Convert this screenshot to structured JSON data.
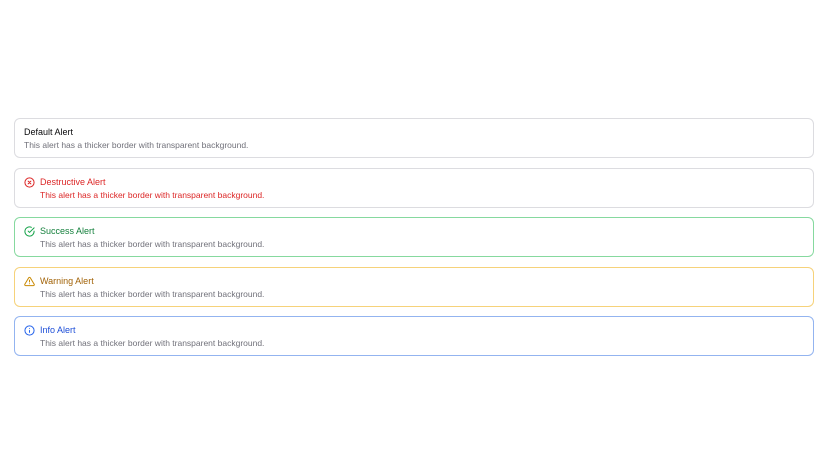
{
  "alerts": [
    {
      "variant": "default",
      "title": "Default Alert",
      "description": "This alert has a thicker border with transparent background.",
      "icon": null,
      "border_color": "#dcdce0",
      "title_color": "#09090b",
      "desc_color": "#71717a"
    },
    {
      "variant": "destructive",
      "title": "Destructive Alert",
      "description": "This alert has a thicker border with transparent background.",
      "icon": "x-circle-icon",
      "border_color": "#dcdce0",
      "title_color": "#dc2626",
      "desc_color": "#dc2626"
    },
    {
      "variant": "success",
      "title": "Success Alert",
      "description": "This alert has a thicker border with transparent background.",
      "icon": "check-circle-icon",
      "border_color": "#86d99f",
      "title_color": "#15803d",
      "desc_color": "#71717a"
    },
    {
      "variant": "warning",
      "title": "Warning Alert",
      "description": "This alert has a thicker border with transparent background.",
      "icon": "warning-triangle-icon",
      "border_color": "#f6d27a",
      "title_color": "#a16207",
      "desc_color": "#71717a"
    },
    {
      "variant": "info",
      "title": "Info Alert",
      "description": "This alert has a thicker border with transparent background.",
      "icon": "info-circle-icon",
      "border_color": "#93b4f0",
      "title_color": "#1d4ed8",
      "desc_color": "#71717a"
    }
  ],
  "icon_colors": {
    "x-circle-icon": "#dc2626",
    "check-circle-icon": "#16a34a",
    "warning-triangle-icon": "#ca8a04",
    "info-circle-icon": "#2563eb"
  }
}
